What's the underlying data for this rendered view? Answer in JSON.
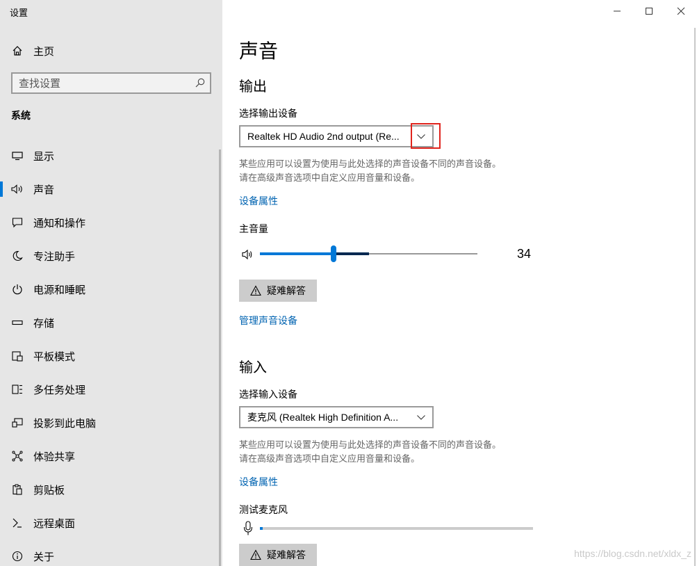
{
  "window": {
    "title": "设置",
    "controls": [
      "minimize-icon",
      "maximize-icon",
      "close-icon"
    ]
  },
  "sidebar": {
    "home_label": "主页",
    "search_placeholder": "查找设置",
    "section_label": "系统",
    "items": [
      {
        "label": "显示",
        "icon": "display-icon",
        "active": false
      },
      {
        "label": "声音",
        "icon": "speaker-icon",
        "active": true
      },
      {
        "label": "通知和操作",
        "icon": "notification-icon",
        "active": false
      },
      {
        "label": "专注助手",
        "icon": "moon-icon",
        "active": false
      },
      {
        "label": "电源和睡眠",
        "icon": "power-icon",
        "active": false
      },
      {
        "label": "存储",
        "icon": "storage-icon",
        "active": false
      },
      {
        "label": "平板模式",
        "icon": "tablet-icon",
        "active": false
      },
      {
        "label": "多任务处理",
        "icon": "multitask-icon",
        "active": false
      },
      {
        "label": "投影到此电脑",
        "icon": "project-icon",
        "active": false
      },
      {
        "label": "体验共享",
        "icon": "share-icon",
        "active": false
      },
      {
        "label": "剪贴板",
        "icon": "clipboard-icon",
        "active": false
      },
      {
        "label": "远程桌面",
        "icon": "remote-icon",
        "active": false
      },
      {
        "label": "关于",
        "icon": "info-icon",
        "active": false
      }
    ]
  },
  "main": {
    "title": "声音",
    "output": {
      "heading": "输出",
      "device_label": "选择输出设备",
      "device_value": "Realtek HD Audio 2nd output (Re...",
      "description_line1": "某些应用可以设置为使用与此处选择的声音设备不同的声音设备。",
      "description_line2": "请在高级声音选项中自定义应用音量和设备。",
      "properties_link": "设备属性",
      "volume_label": "主音量",
      "volume_value": "34",
      "volume_level": 34,
      "troubleshoot_label": "疑难解答",
      "manage_link": "管理声音设备"
    },
    "input": {
      "heading": "输入",
      "device_label": "选择输入设备",
      "device_value": "麦克风 (Realtek High Definition A...",
      "description_line1": "某些应用可以设置为使用与此处选择的声音设备不同的声音设备。",
      "description_line2": "请在高级声音选项中自定义应用音量和设备。",
      "properties_link": "设备属性",
      "test_label": "测试麦克风",
      "mic_level": 1,
      "troubleshoot_label": "疑难解答"
    }
  },
  "colors": {
    "accent": "#0078d7",
    "link": "#0063b1",
    "highlight": "#e0231c",
    "sidebar_bg": "#e6e6e6"
  },
  "watermark": "https://blog.csdn.net/xldx_z"
}
